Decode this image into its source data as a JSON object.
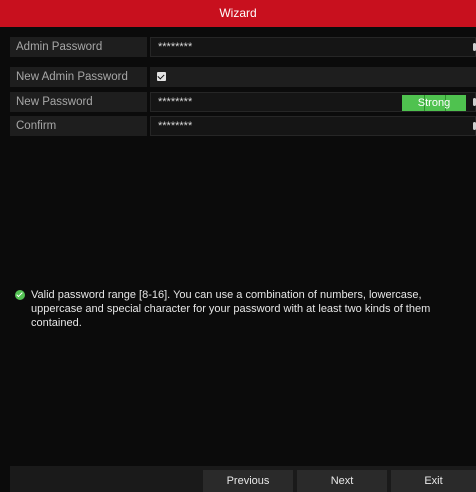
{
  "window": {
    "title": "Wizard"
  },
  "form": {
    "admin_password": {
      "label": "Admin Password",
      "value": "********"
    },
    "new_admin_password": {
      "label": "New Admin Password",
      "checked": true
    },
    "new_password": {
      "label": "New Password",
      "value": "********",
      "strength": "Strong"
    },
    "confirm": {
      "label": "Confirm",
      "value": "********"
    }
  },
  "hint": {
    "icon": "check-circle-icon",
    "text": "Valid password range [8-16]. You can use a combination of numbers, lowercase, uppercase and special character for your password with at least two kinds of them contained."
  },
  "buttons": {
    "previous": "Previous",
    "next": "Next",
    "exit": "Exit"
  },
  "colors": {
    "title_bar": "#c8101e",
    "strength": "#4fc24f",
    "background": "#0b0b0b"
  }
}
